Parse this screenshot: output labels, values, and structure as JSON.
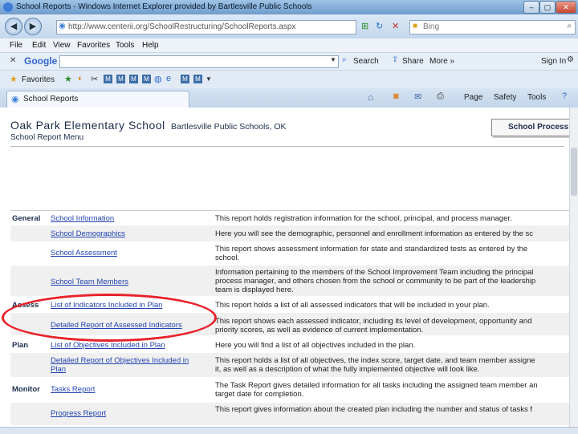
{
  "window": {
    "title": "School Reports - Windows Internet Explorer provided by Bartlesville Public Schools"
  },
  "address": {
    "url": "http://www.centerii.org/SchoolRestructuring/SchoolReports.aspx",
    "search_placeholder": "Bing"
  },
  "menus": [
    "File",
    "Edit",
    "View",
    "Favorites",
    "Tools",
    "Help"
  ],
  "google_bar": {
    "brand": "Google",
    "search_label": "Search",
    "share_label": "Share",
    "more_label": "More »",
    "signin_label": "Sign In"
  },
  "favorites_bar": {
    "label": "Favorites"
  },
  "tab": {
    "title": "School Reports"
  },
  "commands": {
    "page": "Page",
    "safety": "Safety",
    "tools": "Tools"
  },
  "page": {
    "school": "Oak Park Elementary School",
    "district": "Bartlesville Public Schools, OK",
    "menu_label": "School Report Menu",
    "process_button": "School Process M",
    "rows": [
      {
        "section": "General",
        "link": "School Information",
        "desc": [
          "This report holds registration information for the school, principal, and process manager."
        ]
      },
      {
        "section": "",
        "link": "School Demographics",
        "desc": [
          "Here you will see the demographic, personnel and enrollment information as entered by the sc"
        ]
      },
      {
        "section": "",
        "link": "School Assessment",
        "desc": [
          "This report shows assessment information for state and standardized tests as entered by the",
          "school."
        ]
      },
      {
        "section": "",
        "link": "School Team Members",
        "desc": [
          "Information pertaining to the members of the School Improvement Team including the principal",
          "process manager, and others chosen from the school or community to be part of the leadership",
          "team is displayed here."
        ]
      },
      {
        "section": "Assess",
        "link": "List of Indicators Included in Plan",
        "desc": [
          "This report holds a list of all assessed indicators that will be included in your plan."
        ]
      },
      {
        "section": "",
        "link": "Detailed Report of Assessed Indicators",
        "desc": [
          "This report shows each assessed indicator, including its level of development, opportunity and",
          "priority scores, as well as evidence of current implementation."
        ]
      },
      {
        "section": "Plan",
        "link": "List of Objectives Included in Plan",
        "desc": [
          "Here you will find a list of all objectives included in the plan."
        ]
      },
      {
        "section": "",
        "link": [
          "Detailed Report of Objectives Included in",
          "Plan"
        ],
        "desc": [
          "This report holds a list of all objectives, the index score, target date, and team member assigne",
          "it, as well as a description of what the fully implemented objective will look like."
        ]
      },
      {
        "section": "Monitor",
        "link": "Tasks Report",
        "desc": [
          "The Task Report gives detailed information for all tasks including the assigned team member an",
          "target date for completion."
        ]
      },
      {
        "section": "",
        "link": "Progress Report",
        "desc": [
          "This report gives information about the created plan including the number and status of tasks f"
        ]
      }
    ]
  },
  "colors": {
    "link": "#2343b0",
    "annotation": "#e8222a",
    "heading": "#1c2d4a"
  }
}
